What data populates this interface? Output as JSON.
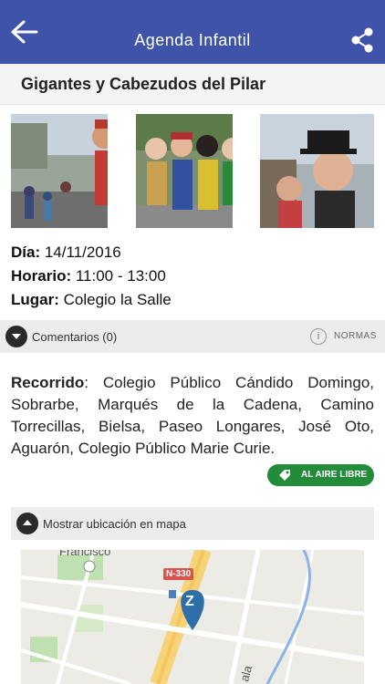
{
  "appbar": {
    "title": "Agenda Infantil",
    "back_icon": "arrow-left-icon",
    "share_icon": "share-icon",
    "color": "#3f53a8"
  },
  "event": {
    "title": "Gigantes y Cabezudos del Pilar",
    "dia_label": "Día:",
    "dia_value": " 14/11/2016",
    "horario_label": "Horario:",
    "horario_value": " 11:00 - 13:00",
    "lugar_label": "Lugar:",
    "lugar_value": " Colegio la Salle"
  },
  "comments": {
    "label": "Comentarios (0)",
    "normas": "NORMAS"
  },
  "route": {
    "label": "Recorrido",
    "text": ": Colegio Público Cándido Domingo, Sobrarbe, Marqués de la Cadena, Camino Torrecillas, Bielsa, Paseo Longares, José Oto, Aguarón, Colegio Público Marie Curie."
  },
  "tag": {
    "label": "AL AIRE LIBRE",
    "color": "#238c3a"
  },
  "map": {
    "toggle_label": "Mostrar ubicación en mapa",
    "place_label": "Francisco",
    "road_label": "N-330",
    "marker_letter": "Z",
    "street_label": "ala"
  }
}
